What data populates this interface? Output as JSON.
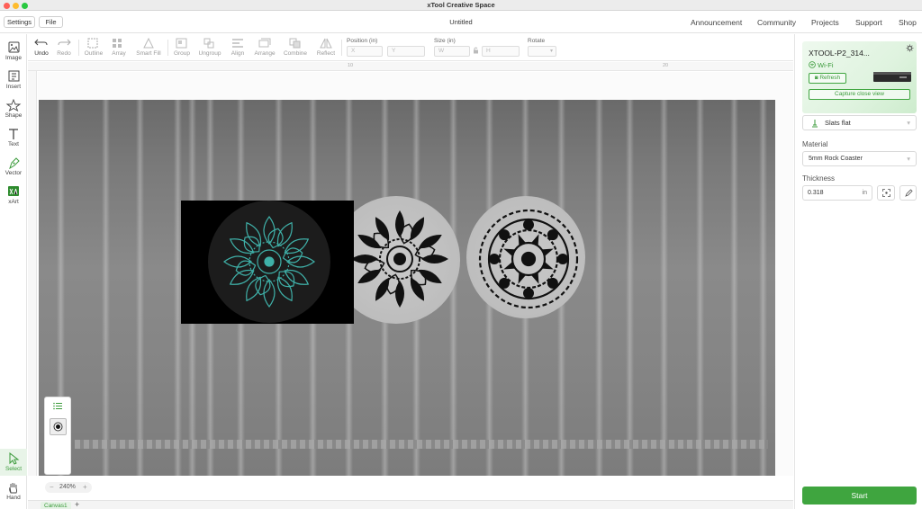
{
  "window": {
    "title": "xTool Creative Space"
  },
  "menubar": {
    "settings_label": "Settings",
    "file_label": "File",
    "doc_title": "Untitled",
    "nav": [
      "Announcement",
      "Community",
      "Projects",
      "Support",
      "Shop"
    ]
  },
  "left_tools": [
    {
      "label": "Image",
      "icon": "image-icon"
    },
    {
      "label": "Insert",
      "icon": "insert-icon"
    },
    {
      "label": "Shape",
      "icon": "shape-icon"
    },
    {
      "label": "Text",
      "icon": "text-icon"
    },
    {
      "label": "Vector",
      "icon": "pen-icon"
    },
    {
      "label": "xArt",
      "icon": "xart-icon"
    },
    {
      "label": "Select",
      "icon": "cursor-icon",
      "active": true
    },
    {
      "label": "Hand",
      "icon": "hand-icon"
    }
  ],
  "toolbar": {
    "undo": "Undo",
    "redo": "Redo",
    "outline": "Outline",
    "array": "Array",
    "smart_fill": "Smart Fill",
    "group": "Group",
    "ungroup": "Ungroup",
    "align": "Align",
    "arrange": "Arrange",
    "combine": "Combine",
    "reflect": "Reflect",
    "position_label": "Position (in)",
    "x_placeholder": "X",
    "y_placeholder": "Y",
    "size_label": "Size (in)",
    "w_placeholder": "W",
    "h_placeholder": "H",
    "rotate_label": "Rotate"
  },
  "rulers": {
    "top": [
      "10",
      "20"
    ]
  },
  "canvas": {
    "zoom": "240%",
    "tab": "Canvas1",
    "add_tab": "+"
  },
  "right_panel": {
    "device_name": "XTOOL-P2_314...",
    "connection": "Wi-Fi",
    "refresh_label": "Refresh",
    "capture_label": "Capture close view",
    "platform": "Slats flat",
    "material_label": "Material",
    "material_value": "5mm Rock Coaster",
    "thickness_label": "Thickness",
    "thickness_value": "0.318",
    "thickness_unit": "in",
    "start_label": "Start"
  },
  "colors": {
    "accent": "#3fa53f",
    "traced": "#3fb0a8"
  }
}
